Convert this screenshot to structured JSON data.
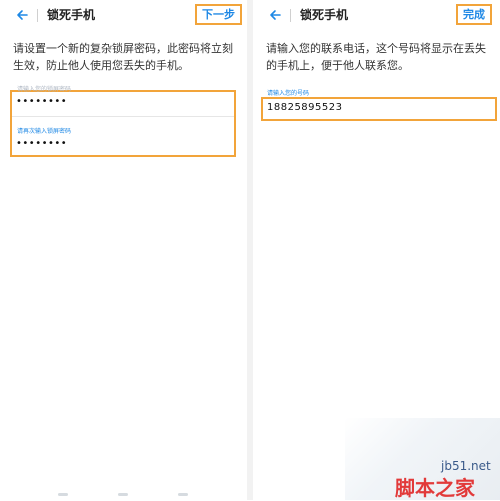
{
  "left_panel": {
    "header": {
      "title": "锁死手机",
      "action_label": "下一步"
    },
    "description": "请设置一个新的复杂锁屏密码，此密码将立刻生效，防止他人使用您丢失的手机。",
    "password_field": {
      "label": "请输入您的锁屏密码",
      "value": "••••••••"
    },
    "confirm_field": {
      "label": "请再次输入锁屏密码",
      "value": "••••••••"
    }
  },
  "right_panel": {
    "header": {
      "title": "锁死手机",
      "action_label": "完成"
    },
    "description": "请输入您的联系电话，这个号码将显示在丢失的手机上，便于他人联系您。",
    "phone_field": {
      "label": "请输入您的号码",
      "value": "18825895523"
    }
  },
  "watermark": {
    "site": "jb51.net",
    "name": "脚本之家"
  },
  "colors": {
    "accent": "#1e88e5",
    "highlight": "#f2a43a"
  }
}
